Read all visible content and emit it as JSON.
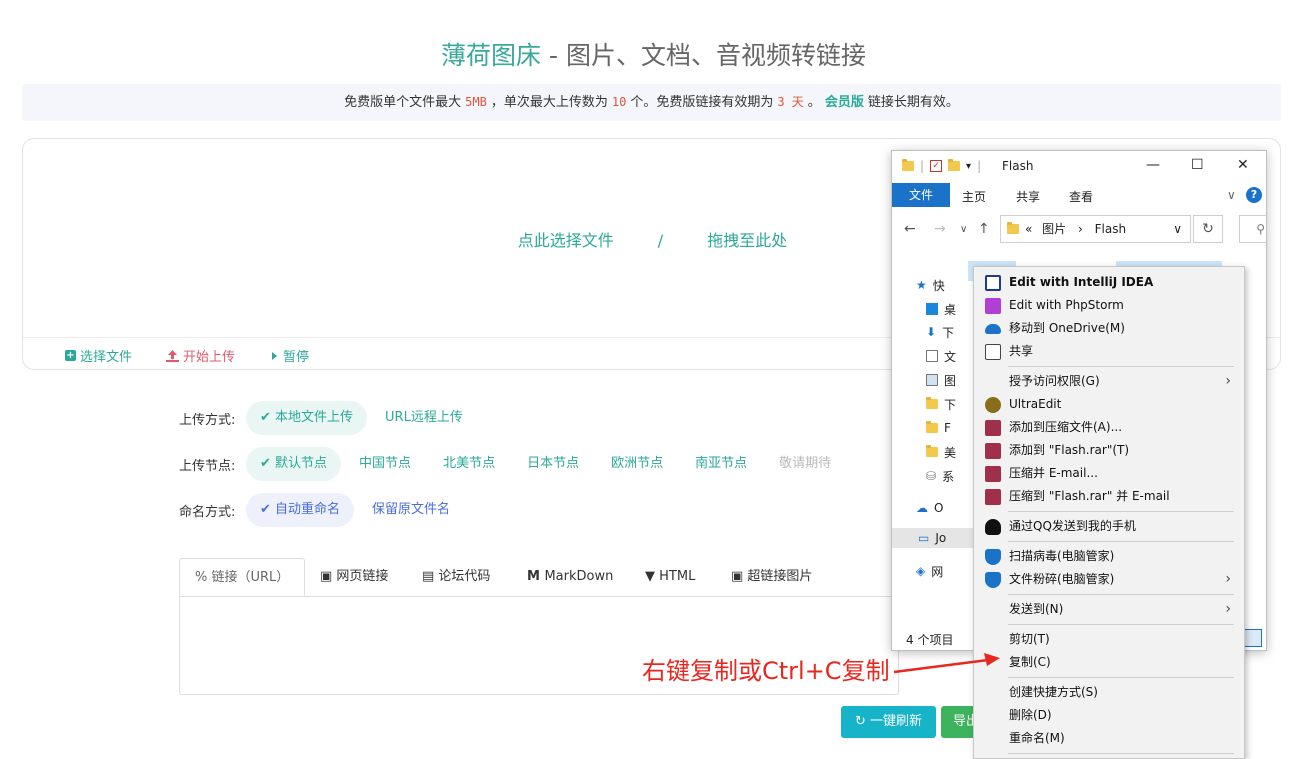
{
  "header": {
    "brand": "薄荷图床",
    "title_rest": " - 图片、文档、音视频转链接"
  },
  "notice": {
    "p1": "免费版单个文件最大",
    "size": "5MB",
    "p2": "，单次最大上传数为",
    "count": "10",
    "p3": "个。免费版链接有效期为",
    "days": "3 天",
    "p4": "。",
    "vip": "会员版",
    "p5": "链接长期有效。"
  },
  "upload": {
    "choose": "点此选择文件",
    "slash": "/",
    "drag": "拖拽至此处",
    "actions": {
      "select": "选择文件",
      "start": "开始上传",
      "pause": "暂停"
    }
  },
  "options": {
    "method": {
      "label": "上传方式:",
      "items": [
        "本地文件上传",
        "URL远程上传"
      ],
      "active": 0
    },
    "node": {
      "label": "上传节点:",
      "items": [
        "默认节点",
        "中国节点",
        "北美节点",
        "日本节点",
        "欧洲节点",
        "南亚节点",
        "敬请期待"
      ],
      "active": 0
    },
    "naming": {
      "label": "命名方式:",
      "items": [
        "自动重命名",
        "保留原文件名"
      ],
      "active": 0
    }
  },
  "link_tabs": [
    "链接（URL）",
    "网页链接",
    "论坛代码",
    "MarkDown",
    "HTML",
    "超链接图片"
  ],
  "buttons": {
    "refresh": "一键刷新",
    "export": "导出"
  },
  "explorer": {
    "title": "Flash",
    "ribbon": {
      "file": "文件",
      "home": "主页",
      "share": "共享",
      "view": "查看"
    },
    "breadcrumb": {
      "prefix": "«",
      "part1": "图片",
      "sep": "›",
      "part2": "Flash"
    },
    "nav_items": [
      "快",
      "桌",
      "下",
      "文",
      "图",
      "下",
      "F",
      "美",
      "系",
      "O",
      "Jo",
      "网"
    ],
    "status": "4 个项目"
  },
  "context_menu": {
    "items": [
      {
        "label": "Edit with IntelliJ IDEA",
        "icon": "intellij-icon",
        "color": "#1e3a8a"
      },
      {
        "label": "Edit with PhpStorm",
        "icon": "phpstorm-icon",
        "color": "#b03fd6"
      },
      {
        "label": "移动到 OneDrive(M)",
        "icon": "onedrive-icon",
        "color": "#1a73c8"
      },
      {
        "label": "共享",
        "icon": "share-icon",
        "color": "#444"
      },
      {
        "label": "授予访问权限(G)",
        "icon": "",
        "color": ""
      },
      {
        "label": "UltraEdit",
        "icon": "ultraedit-icon",
        "color": "#8a6d1a"
      },
      {
        "label": "添加到压缩文件(A)...",
        "icon": "winrar-icon",
        "color": "#a0304a"
      },
      {
        "label": "添加到 \"Flash.rar\"(T)",
        "icon": "winrar-icon",
        "color": "#a0304a"
      },
      {
        "label": "压缩并 E-mail...",
        "icon": "winrar-icon",
        "color": "#a0304a"
      },
      {
        "label": "压缩到 \"Flash.rar\" 并 E-mail",
        "icon": "winrar-icon",
        "color": "#a0304a"
      },
      {
        "label": "通过QQ发送到我的手机",
        "icon": "qq-icon",
        "color": "#111"
      },
      {
        "label": "扫描病毒(电脑管家)",
        "icon": "tencent-pc-manager-icon",
        "color": "#1a73c8"
      },
      {
        "label": "文件粉碎(电脑管家)",
        "icon": "tencent-pc-manager-icon",
        "color": "#1a73c8"
      },
      {
        "label": "发送到(N)",
        "icon": "",
        "color": ""
      },
      {
        "label": "剪切(T)",
        "icon": "",
        "color": ""
      },
      {
        "label": "复制(C)",
        "icon": "",
        "color": ""
      },
      {
        "label": "创建快捷方式(S)",
        "icon": "",
        "color": ""
      },
      {
        "label": "删除(D)",
        "icon": "",
        "color": ""
      },
      {
        "label": "重命名(M)",
        "icon": "",
        "color": ""
      }
    ]
  },
  "annotation": "右键复制或Ctrl+C复制",
  "colors": {
    "accent": "#2aa998",
    "danger": "#e0543b",
    "annotation": "#e8281e",
    "refresh": "#17b4c9",
    "export": "#3cb35c"
  }
}
